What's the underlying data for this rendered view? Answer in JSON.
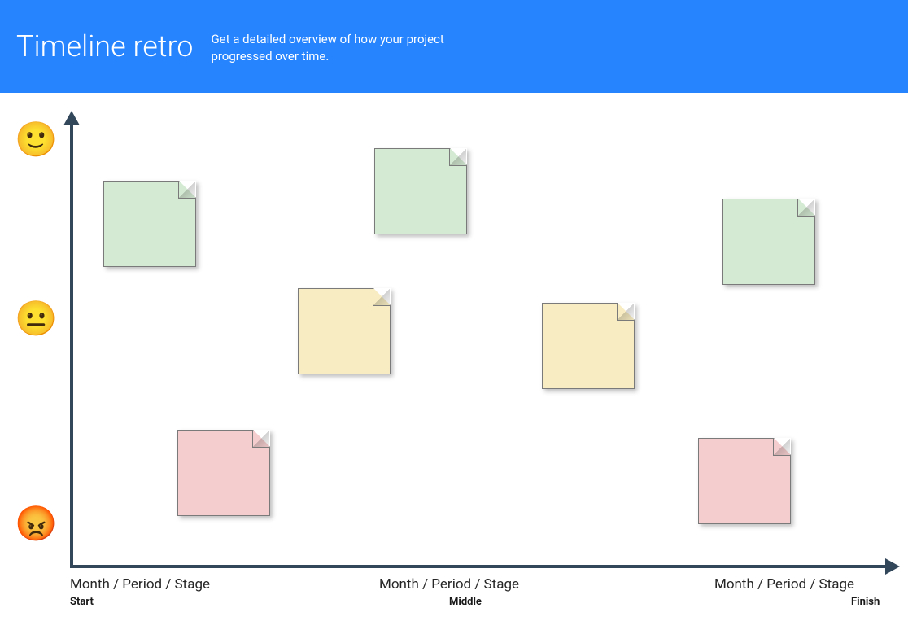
{
  "header": {
    "title": "Timeline retro",
    "description": "Get a detailed overview of how your project progressed over time."
  },
  "emojis": {
    "happy": "🙂",
    "neutral": "😐",
    "angry": "😡"
  },
  "xaxis": {
    "labels": [
      "Month / Period / Stage",
      "Month / Period / Stage",
      "Month / Period / Stage"
    ],
    "sublabels": [
      "Start",
      "Middle",
      "Finish"
    ]
  },
  "notes": [
    {
      "id": "s1",
      "color": "green"
    },
    {
      "id": "s2",
      "color": "green"
    },
    {
      "id": "s3",
      "color": "green"
    },
    {
      "id": "s4",
      "color": "yellow"
    },
    {
      "id": "s5",
      "color": "yellow"
    },
    {
      "id": "s6",
      "color": "pink"
    },
    {
      "id": "s7",
      "color": "pink"
    }
  ]
}
